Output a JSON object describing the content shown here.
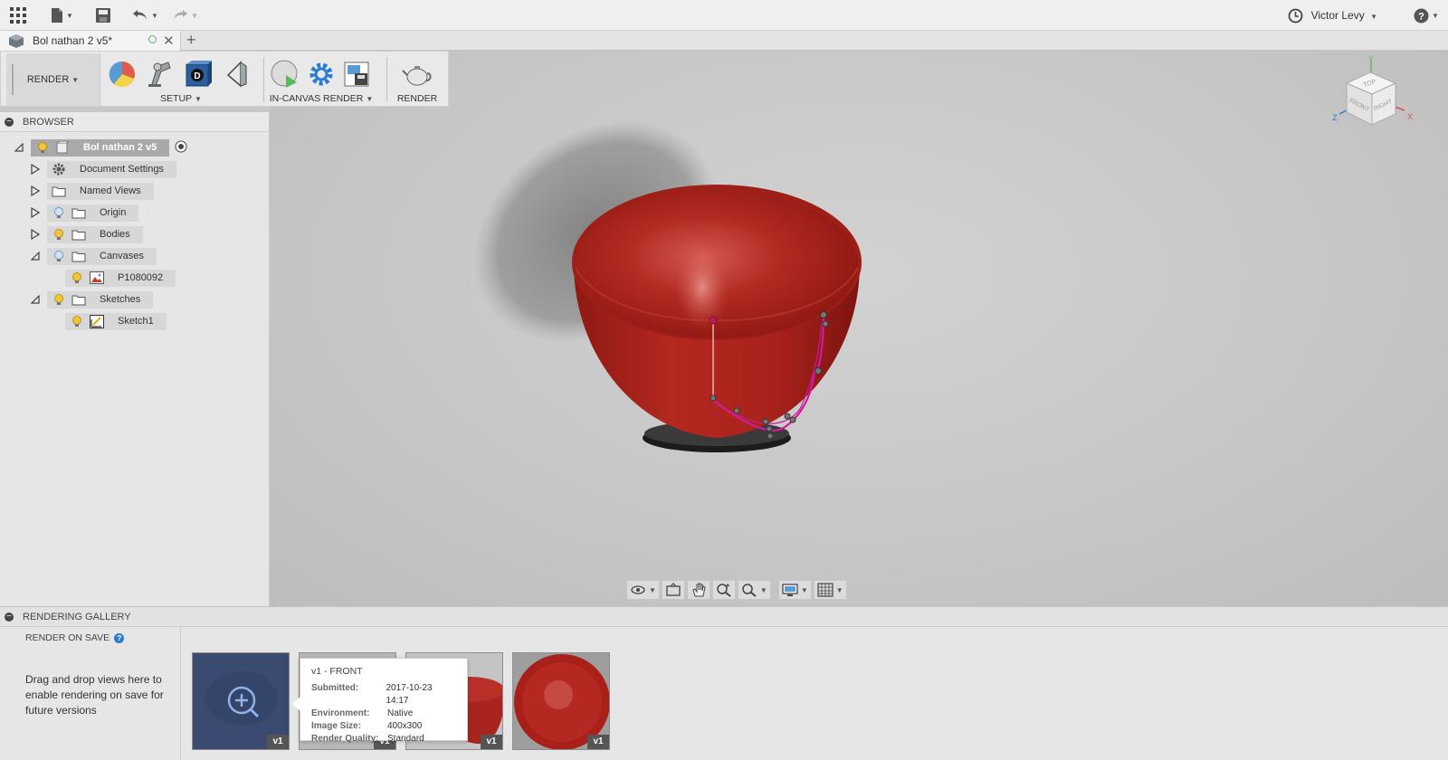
{
  "appbar": {
    "user_name": "Victor Levy"
  },
  "tab": {
    "title": "Bol nathan 2 v5*"
  },
  "toolbar": {
    "workspace": "RENDER",
    "setup_label": "SETUP",
    "incanvas_label": "IN-CANVAS RENDER",
    "render_label": "RENDER"
  },
  "browser": {
    "title": "BROWSER",
    "root": "Bol nathan 2 v5",
    "items": [
      {
        "label": "Document Settings"
      },
      {
        "label": "Named Views"
      },
      {
        "label": "Origin"
      },
      {
        "label": "Bodies"
      },
      {
        "label": "Canvases"
      },
      {
        "label": "P1080092"
      },
      {
        "label": "Sketches"
      },
      {
        "label": "Sketch1"
      }
    ]
  },
  "viewcube": {
    "top": "TOP",
    "front": "FRONT",
    "right": "RIGHT",
    "axis_x": "X",
    "axis_y": "Y",
    "axis_z": "Z"
  },
  "gallery": {
    "title": "RENDERING GALLERY",
    "render_on_save": "RENDER ON SAVE",
    "help": "?",
    "drop_hint": "Drag and drop views here to enable rendering on save for future versions",
    "thumbs": [
      {
        "badge": "v1"
      },
      {
        "badge": "v1"
      },
      {
        "badge": "v1"
      },
      {
        "badge": "v1"
      }
    ]
  },
  "tooltip": {
    "title": "v1 - FRONT",
    "submitted_label": "Submitted:",
    "submitted": "2017-10-23 14:17",
    "environment_label": "Environment:",
    "environment": "Native",
    "size_label": "Image Size:",
    "size": "400x300",
    "quality_label": "Render Quality:",
    "quality": "Standard"
  },
  "colors": {
    "bowl_red": "#b8221c",
    "sketch_magenta": "#d4199e",
    "accent_blue": "#2c7bd3"
  }
}
